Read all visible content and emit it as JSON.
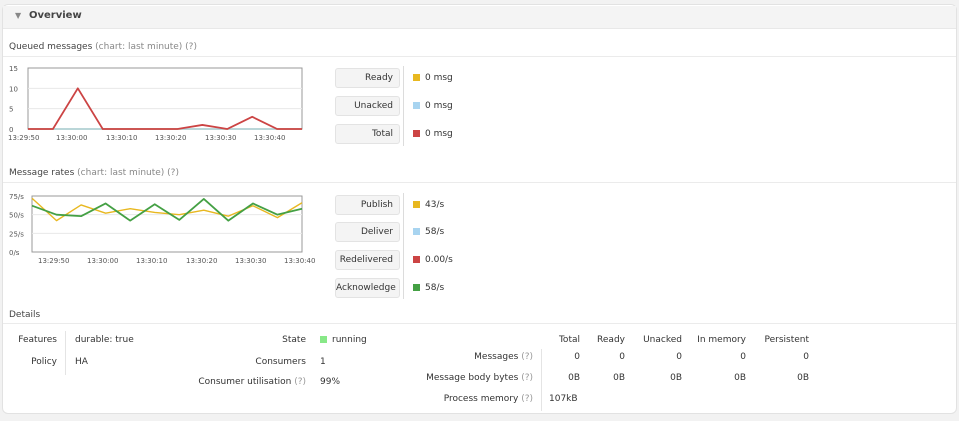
{
  "overview": {
    "title": "Overview"
  },
  "queued": {
    "title": "Queued messages",
    "subtitle": "(chart: last minute) (?)",
    "legend": [
      {
        "label": "Ready",
        "value": "0 msg",
        "color": "#e8b820"
      },
      {
        "label": "Unacked",
        "value": "0 msg",
        "color": "#a8d4f0"
      },
      {
        "label": "Total",
        "value": "0 msg",
        "color": "#cc4444"
      }
    ]
  },
  "rates": {
    "title": "Message rates",
    "subtitle": "(chart: last minute) (?)",
    "legend": [
      {
        "label": "Publish",
        "value": "43/s",
        "color": "#e8b820"
      },
      {
        "label": "Deliver",
        "value": "58/s",
        "color": "#a8d4f0"
      },
      {
        "label": "Redelivered",
        "value": "0.00/s",
        "color": "#cc4444"
      },
      {
        "label": "Acknowledge",
        "value": "58/s",
        "color": "#44a044"
      }
    ]
  },
  "details": {
    "title": "Details",
    "features_label": "Features",
    "features_value": "durable: true",
    "policy_label": "Policy",
    "policy_value": "HA",
    "state_label": "State",
    "state_value": "running",
    "state_color": "#88e888",
    "consumers_label": "Consumers",
    "consumers_value": "1",
    "utilisation_label": "Consumer utilisation",
    "utilisation_help": "(?)",
    "utilisation_value": "99%",
    "table": {
      "columns": [
        "Total",
        "Ready",
        "Unacked",
        "In memory",
        "Persistent"
      ],
      "rows": [
        {
          "label": "Messages",
          "help": "(?)",
          "values": [
            "0",
            "0",
            "0",
            "0",
            "0"
          ]
        },
        {
          "label": "Message body bytes",
          "help": "(?)",
          "values": [
            "0B",
            "0B",
            "0B",
            "0B",
            "0B"
          ]
        },
        {
          "label": "Process memory",
          "help": "(?)",
          "values": [
            "107kB"
          ]
        }
      ]
    }
  },
  "chart_data": [
    {
      "type": "line",
      "title": "Queued messages",
      "x_ticks": [
        "13:29:50",
        "13:30:00",
        "13:30:10",
        "13:30:20",
        "13:30:30",
        "13:30:40"
      ],
      "y_ticks": [
        "0",
        "5",
        "10",
        "15"
      ],
      "ylim": [
        0,
        15
      ],
      "x": [
        "13:29:50",
        "13:29:55",
        "13:30:00",
        "13:30:05",
        "13:30:10",
        "13:30:15",
        "13:30:20",
        "13:30:25",
        "13:30:30",
        "13:30:35",
        "13:30:40",
        "13:30:45"
      ],
      "series": [
        {
          "name": "Ready",
          "color": "#e8b820",
          "values": [
            0,
            0,
            0,
            0,
            0,
            0,
            0,
            0,
            0,
            0,
            0,
            0
          ]
        },
        {
          "name": "Unacked",
          "color": "#a8d4f0",
          "values": [
            0,
            0,
            0,
            0,
            0,
            0,
            0,
            0,
            0,
            0,
            0,
            0
          ]
        },
        {
          "name": "Total",
          "color": "#cc4444",
          "values": [
            0,
            0,
            10,
            0,
            0,
            0,
            0,
            1,
            0,
            3,
            0,
            0
          ]
        }
      ],
      "grid": true,
      "legend": "right"
    },
    {
      "type": "line",
      "title": "Message rates",
      "x_ticks": [
        "13:29:50",
        "13:30:00",
        "13:30:10",
        "13:30:20",
        "13:30:30",
        "13:30:40"
      ],
      "y_ticks": [
        "0/s",
        "25/s",
        "50/s",
        "75/s"
      ],
      "ylim": [
        0,
        75
      ],
      "x": [
        "13:29:45",
        "13:29:50",
        "13:29:55",
        "13:30:00",
        "13:30:05",
        "13:30:10",
        "13:30:15",
        "13:30:20",
        "13:30:25",
        "13:30:30",
        "13:30:35",
        "13:30:40"
      ],
      "series": [
        {
          "name": "Publish",
          "color": "#e8b820",
          "values": [
            72,
            42,
            63,
            52,
            58,
            53,
            50,
            56,
            48,
            62,
            46,
            66
          ]
        },
        {
          "name": "Acknowledge",
          "color": "#44a044",
          "values": [
            62,
            50,
            48,
            65,
            42,
            64,
            43,
            71,
            42,
            65,
            50,
            58
          ]
        }
      ],
      "grid": true,
      "legend": "right"
    }
  ]
}
